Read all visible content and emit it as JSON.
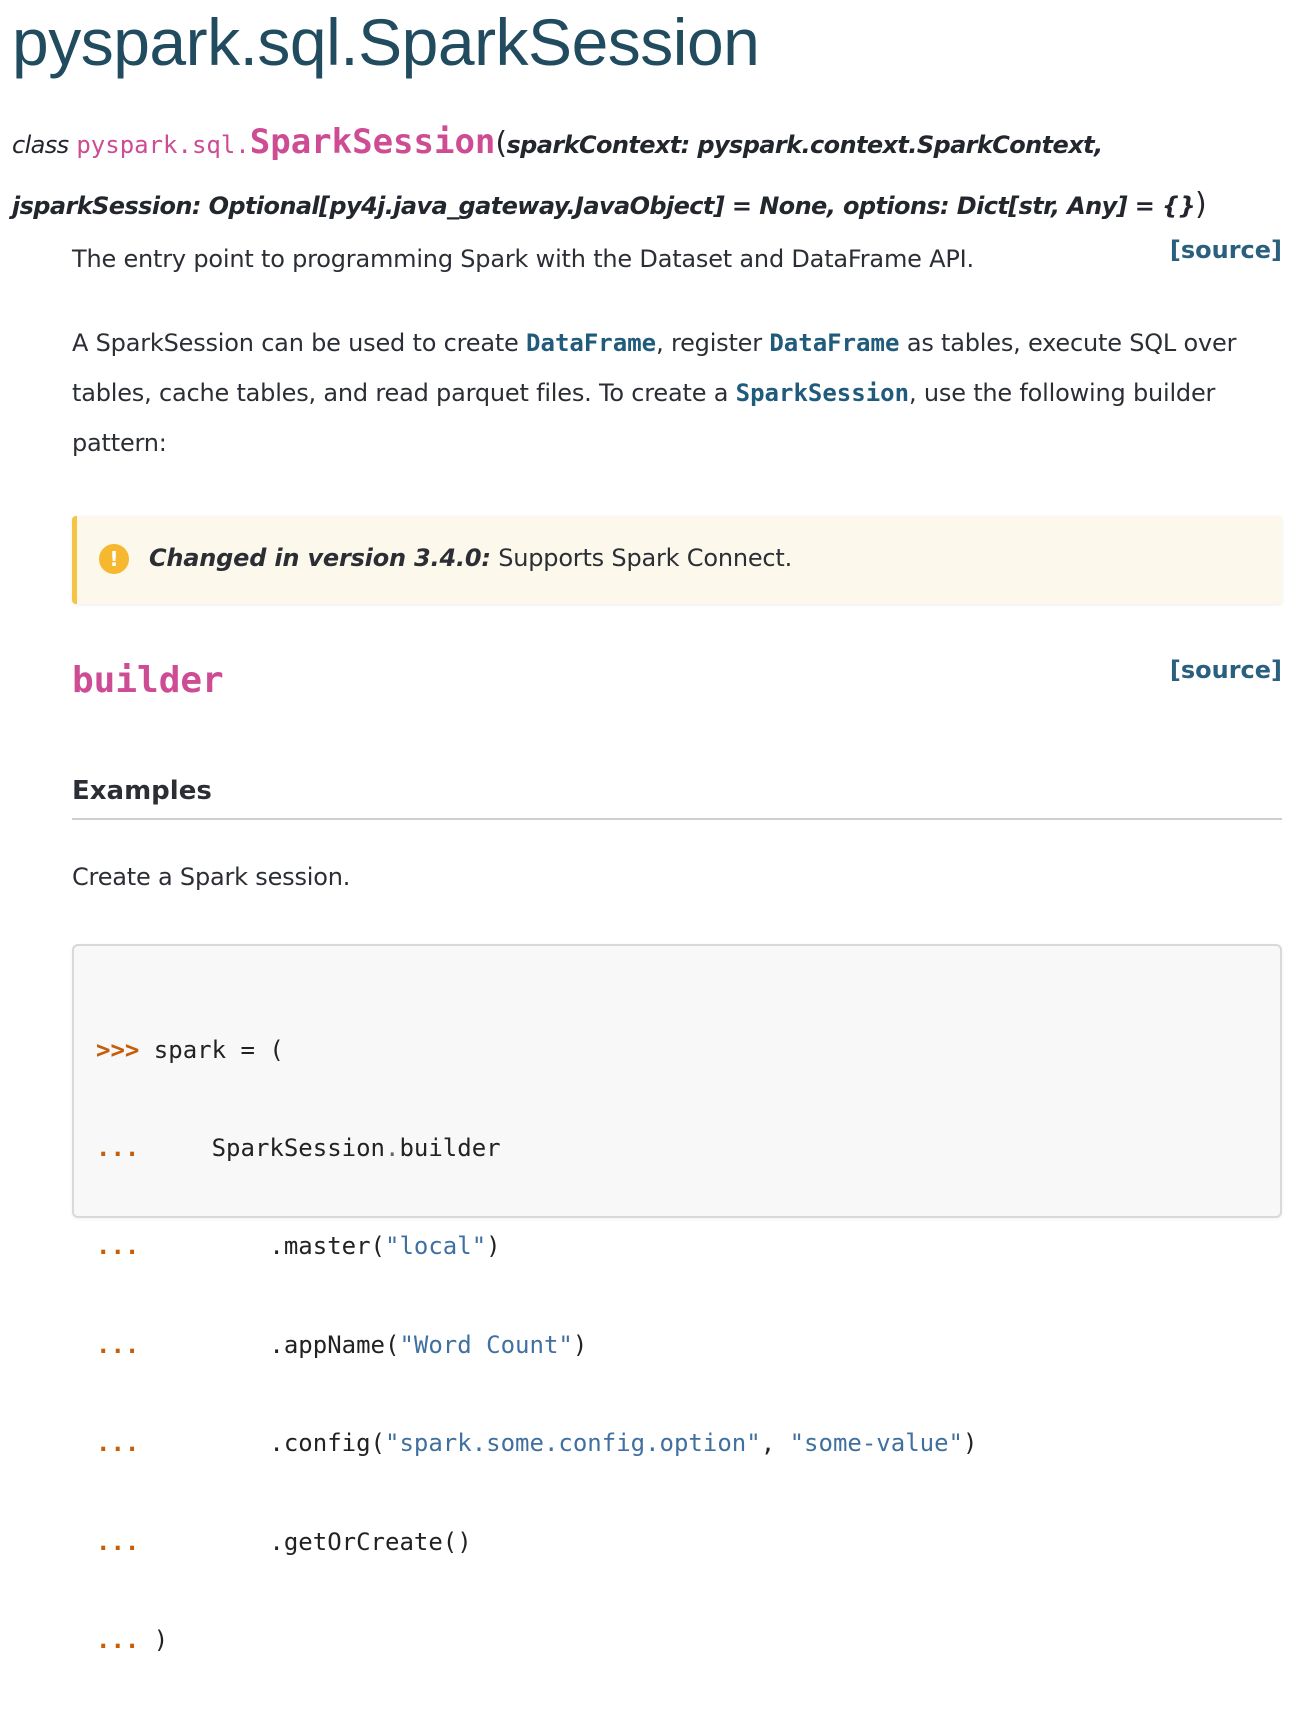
{
  "page_title": "pyspark.sql.SparkSession",
  "signature": {
    "keyword": "class",
    "prefix": "pyspark.sql.",
    "class_name": "SparkSession",
    "open_paren": "(",
    "params_line1": "sparkContext: pyspark.context.SparkContext,",
    "params_line2": "jsparkSession: Optional[py4j.java_gateway.JavaObject] = None, options: Dict[str, Any] = {}",
    "close_paren": ")"
  },
  "source_link": "[source]",
  "intro": "The entry point to programming Spark with the Dataset and DataFrame API.",
  "description": {
    "part1": "A SparkSession can be used to create ",
    "ref1": "DataFrame",
    "part2": ", register ",
    "ref2": "DataFrame",
    "part3": " as tables, execute SQL over tables, cache tables, and read parquet files. To create a ",
    "ref3": "SparkSession",
    "part4": ", use the following builder pattern:"
  },
  "admonition": {
    "icon": "exclamation-icon",
    "version_label": "Changed in version 3.4.0:",
    "text": " Supports Spark Connect."
  },
  "attribute": {
    "name": "builder",
    "source_link": "[source]"
  },
  "examples": {
    "heading": "Examples",
    "text": "Create a Spark session."
  },
  "code": {
    "prompt_first": ">>>",
    "prompt_cont": "...",
    "l1": " spark = (",
    "l2_a": "     SparkSession",
    "l2_dot": ".",
    "l2_b": "builder",
    "l3_a": "         .master(",
    "l3_s": "\"local\"",
    "l3_b": ")",
    "l4_a": "         .appName(",
    "l4_s": "\"Word Count\"",
    "l4_b": ")",
    "l5_a": "         .config(",
    "l5_s1": "\"spark.some.config.option\"",
    "l5_sep": ", ",
    "l5_s2": "\"some-value\"",
    "l5_b": ")",
    "l6": "         .getOrCreate()",
    "l7": " )"
  },
  "colors": {
    "title": "#214b5f",
    "accent_pink": "#cd4c94",
    "link": "#2a5f7d",
    "admonition_border": "#f6c344",
    "admonition_bg": "#fdf8ec",
    "prompt": "#c65d09",
    "string": "#4070a0"
  }
}
